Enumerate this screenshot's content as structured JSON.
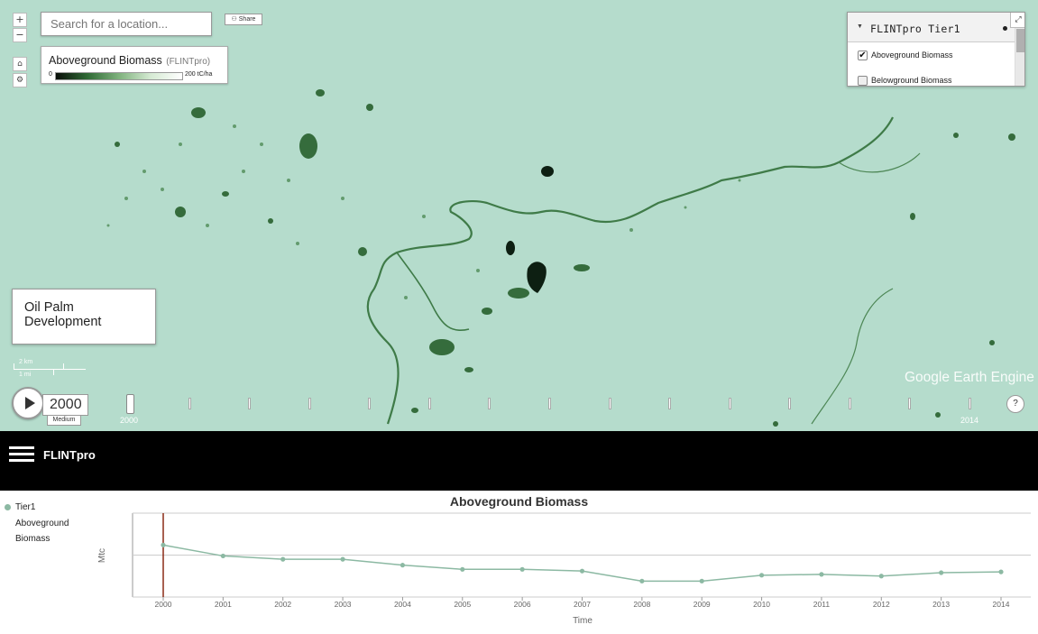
{
  "map": {
    "search_placeholder": "Search for a location...",
    "zoom_in": "+",
    "zoom_out": "−",
    "home_icon": "⌂",
    "settings_icon": "⚙",
    "share_label": "Share",
    "watermark": "Google Earth Engine",
    "scale": {
      "km": "2 km",
      "mi": "1 mi"
    },
    "legend": {
      "title": "Aboveground Biomass",
      "source": "(FLINTpro)",
      "min": "0",
      "max": "200 tC/ha"
    },
    "layers_panel": {
      "title": "FLINTpro Tier1",
      "items": [
        {
          "label": "Aboveground Biomass",
          "checked": true
        },
        {
          "label": "Belowground Biomass",
          "checked": false
        }
      ]
    },
    "annotation": "Oil Palm Development",
    "timeline": {
      "current_year": "2000",
      "speed": "Medium",
      "start_label": "2000",
      "end_label": "2014",
      "years": [
        "2000",
        "2001",
        "2002",
        "2003",
        "2004",
        "2005",
        "2006",
        "2007",
        "2008",
        "2009",
        "2010",
        "2011",
        "2012",
        "2013",
        "2014"
      ],
      "help": "?"
    },
    "colors": {
      "water_land": "#b5dccc",
      "vegetation": "#2f6a35"
    }
  },
  "header": {
    "brand": "FLINTpro"
  },
  "legend_series": {
    "name": "Tier1",
    "label_line1": "Aboveground",
    "label_line2": "Biomass",
    "color": "#8cb9a3"
  },
  "chart_data": {
    "type": "line",
    "title": "Aboveground Biomass",
    "xlabel": "Time",
    "ylabel": "Mtc",
    "categories": [
      "2000",
      "2001",
      "2002",
      "2003",
      "2004",
      "2005",
      "2006",
      "2007",
      "2008",
      "2009",
      "2010",
      "2011",
      "2012",
      "2013",
      "2014"
    ],
    "series": [
      {
        "name": "Tier1 Aboveground Biomass",
        "values": [
          0.62,
          0.49,
          0.45,
          0.45,
          0.38,
          0.33,
          0.33,
          0.31,
          0.19,
          0.19,
          0.26,
          0.27,
          0.25,
          0.29,
          0.3
        ]
      }
    ],
    "ylim": [
      0,
      1
    ],
    "grid": "horizontal",
    "marker_year": "2000",
    "marker_color": "#8b2a16",
    "series_color": "#8cb9a3"
  }
}
